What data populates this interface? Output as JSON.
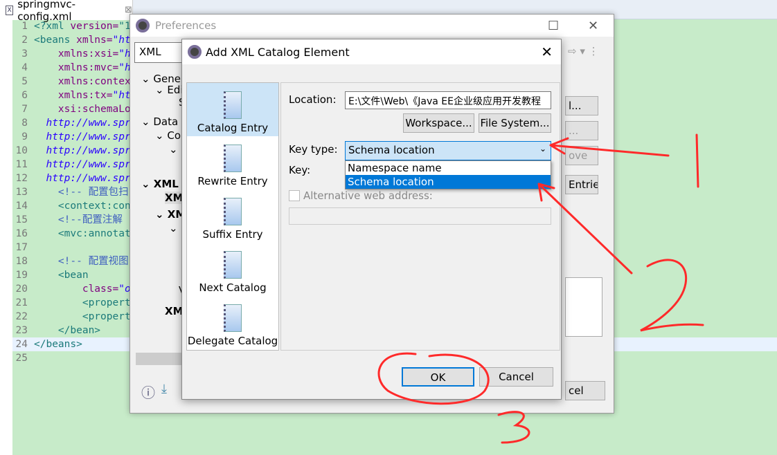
{
  "editor": {
    "tab_title": "springmvc-config.xml",
    "tab_close": "⊠",
    "lines": [
      {
        "n": "1",
        "html": [
          [
            "tag",
            "<?xml "
          ],
          [
            "attr",
            "version="
          ],
          [
            "tag",
            "\"1"
          ]
        ]
      },
      {
        "n": "2",
        "html": [
          [
            "tag",
            "<beans "
          ],
          [
            "attr",
            "xmlns="
          ],
          [
            "url",
            "\"ht"
          ]
        ]
      },
      {
        "n": "3",
        "html": [
          [
            "attr",
            "    xmlns:xsi="
          ],
          [
            "url",
            "\"h"
          ]
        ]
      },
      {
        "n": "4",
        "html": [
          [
            "attr",
            "    xmlns:mvc="
          ],
          [
            "url",
            "\"h"
          ]
        ]
      },
      {
        "n": "5",
        "html": [
          [
            "attr",
            "    xmlns:contex"
          ]
        ]
      },
      {
        "n": "6",
        "html": [
          [
            "attr",
            "    xmlns:tx="
          ],
          [
            "url",
            "\"ht"
          ]
        ]
      },
      {
        "n": "7",
        "html": [
          [
            "attr",
            "    xsi:schemaLo"
          ]
        ]
      },
      {
        "n": "8",
        "html": [
          [
            "url",
            "  http://www.spr"
          ]
        ]
      },
      {
        "n": "9",
        "html": [
          [
            "url",
            "  http://www.spr"
          ]
        ]
      },
      {
        "n": "10",
        "html": [
          [
            "url",
            "  http://www.spr"
          ]
        ]
      },
      {
        "n": "11",
        "html": [
          [
            "url",
            "  http://www.spr"
          ]
        ]
      },
      {
        "n": "12",
        "html": [
          [
            "url",
            "  http://www.spr"
          ]
        ]
      },
      {
        "n": "13",
        "html": [
          [
            "cm",
            "    <!-- 配置包扫"
          ]
        ]
      },
      {
        "n": "14",
        "html": [
          [
            "tag",
            "    <context:con"
          ]
        ]
      },
      {
        "n": "15",
        "html": [
          [
            "cm",
            "    <!--配置注解"
          ]
        ]
      },
      {
        "n": "16",
        "html": [
          [
            "tag",
            "    <mvc:annotat"
          ]
        ]
      },
      {
        "n": "17",
        "html": []
      },
      {
        "n": "18",
        "html": [
          [
            "cm",
            "    <!-- 配置视图"
          ]
        ]
      },
      {
        "n": "19",
        "html": [
          [
            "tag",
            "    <bean"
          ]
        ]
      },
      {
        "n": "20",
        "html": [
          [
            "attr",
            "        class="
          ],
          [
            "url",
            "\"o"
          ]
        ]
      },
      {
        "n": "21",
        "html": [
          [
            "tag",
            "        <propert"
          ]
        ]
      },
      {
        "n": "22",
        "html": [
          [
            "tag",
            "        <propert"
          ]
        ]
      },
      {
        "n": "23",
        "html": [
          [
            "tag",
            "    </bean>"
          ]
        ]
      },
      {
        "n": "24",
        "html": [
          [
            "tag",
            "</beans>"
          ]
        ]
      },
      {
        "n": "25",
        "html": []
      }
    ]
  },
  "preferences": {
    "title": "Preferences",
    "search_value": "XML",
    "tree": [
      "Gener",
      "Edi",
      "S",
      "Data M",
      "Con",
      "C",
      "XML",
      "XM",
      "XM",
      "I",
      "V",
      "XM"
    ],
    "side_buttons": [
      "l...",
      "...",
      "ove",
      "Entries"
    ],
    "cancel_partial": "cel"
  },
  "dialog": {
    "title": "Add XML Catalog Element",
    "close": "✕",
    "entries": [
      {
        "label": "Catalog Entry",
        "selected": true
      },
      {
        "label": "Rewrite Entry"
      },
      {
        "label": "Suffix Entry"
      },
      {
        "label": "Next Catalog"
      },
      {
        "label": "Delegate Catalog"
      }
    ],
    "location_label": "Location:",
    "location_value": "E:\\文件\\Web\\《Java EE企业级应用开发教程",
    "workspace_button": "Workspace...",
    "filesystem_button": "File System...",
    "key_type_label": "Key type:",
    "key_type_value": "Schema location",
    "key_type_options": [
      "Namespace name",
      "Schema location"
    ],
    "key_label": "Key:",
    "alt_label": "Alternative web address:",
    "alt_checked": false,
    "ok": "OK",
    "cancel": "Cancel"
  },
  "annotations": {
    "color": "#ff2a2a"
  }
}
